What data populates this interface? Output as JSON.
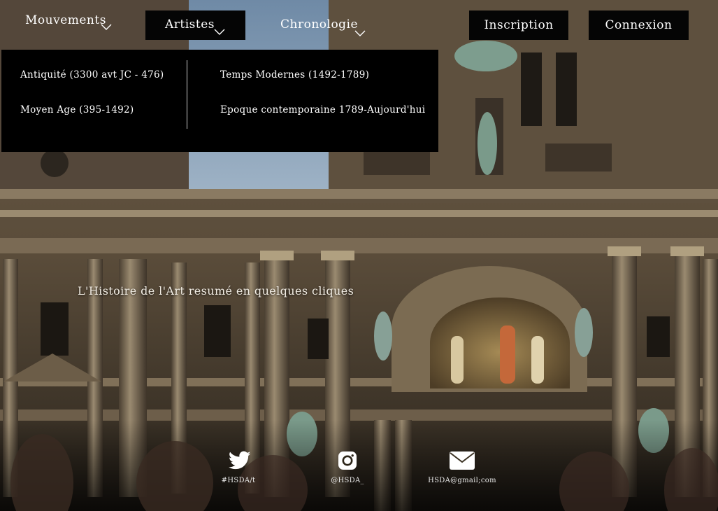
{
  "nav": {
    "mouvements": "Mouvements",
    "artistes": "Artistes",
    "chronologie": "Chronologie",
    "inscription": "Inscription",
    "connexion": "Connexion"
  },
  "dropdown": {
    "items": [
      "Antiquité  (3300 avt JC - 476)",
      "Moyen Age (395-1492)",
      "Temps Modernes (1492-1789)",
      "Epoque contemporaine 1789-Aujourd'hui"
    ]
  },
  "hero": {
    "tagline": "L'Histoire de l'Art  resumé en quelques cliques"
  },
  "footer": {
    "twitter": "#HSDA/t",
    "instagram": "@HSDA_",
    "email": "HSDA@gmail;com"
  },
  "icons": {
    "chevron": "chevron-down-icon",
    "twitter": "twitter-icon",
    "instagram": "instagram-icon",
    "email": "envelope-icon"
  },
  "colors": {
    "nav_bg": "#050505",
    "text": "#ffffff"
  }
}
